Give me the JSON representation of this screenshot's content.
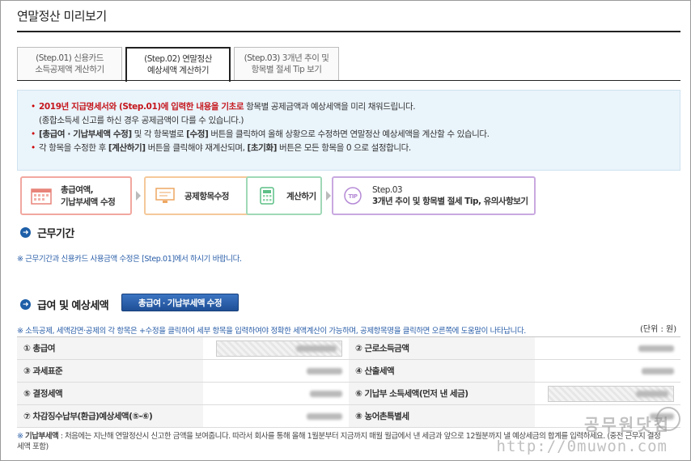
{
  "page": {
    "title": "연말정산 미리보기"
  },
  "tabs": [
    {
      "step": "(Step.01)",
      "line1": "신용카드",
      "line2": "소득공제액 계산하기",
      "active": false
    },
    {
      "step": "(Step.02)",
      "line1": "연말정산",
      "line2": "예상세액 계산하기",
      "active": true
    },
    {
      "step": "(Step.03)",
      "line1": "3개년 추이 및",
      "line2": "항목별 절세 Tip 보기",
      "active": false
    }
  ],
  "info": {
    "line1_red": "2019년 지급명세서와 (Step.01)에 입력한 내용을 기초로",
    "line1_rest": " 항목별 공제금액과 예상세액을 미리 채워드립니다.",
    "line1_sub": "(종합소득세 신고를 하신 경우 공제금액이 다를 수 있습니다.)",
    "line2_b1": "[총급여 · 기납부세액 수정]",
    "line2_mid": " 및 각 항목별로 ",
    "line2_b2": "[수정]",
    "line2_rest": " 버튼을 클릭하여 올해 상황으로 수정하면 연말정산 예상세액을 계산할 수 있습니다.",
    "line3_a": "각 항목을 수정한 후 ",
    "line3_b1": "[계산하기]",
    "line3_mid": " 버튼을 클릭해야 재계산되며, ",
    "line3_b2": "[초기화]",
    "line3_rest": " 버튼은 모든 항목을 0 으로 설정합니다."
  },
  "steps": [
    {
      "line1": "총급여액,",
      "line2": "기납부세액 수정",
      "color": "#f2a7a0",
      "icon": "calendar-icon"
    },
    {
      "line1": "공제항목수정",
      "line2": "",
      "color": "#f5c89a",
      "icon": "monitor-icon"
    },
    {
      "line1": "계산하기",
      "line2": "",
      "color": "#9fd9b6",
      "icon": "calculator-icon"
    },
    {
      "line1": "Step.03",
      "line2": "3개년 추이 및 항목별 절세 Tip, 유의사항보기",
      "color": "#c9a9e0",
      "icon": "tip-icon",
      "tip_label": "TIP"
    }
  ],
  "section_work": {
    "title": "근무기간",
    "note": "※ 근무기간과 신용카드 사용금액 수정은 [Step.01]에서 하시기 바랍니다."
  },
  "section_salary": {
    "title": "급여 및 예상세액",
    "edit_button": "총급여 · 기납부세액 수정",
    "note": "※ 소득공제, 세액감면·공제의 각 항목은 +수정을 클릭하여 세부 항목을 입력하여야 정확한 세액계산이 가능하며, 공제항목명을 클릭하면 오른쪽에 도움말이 나타납니다.",
    "unit": "(단위 : 원)",
    "rows": [
      {
        "l_label": "① 총급여",
        "l_boxed": true,
        "r_label": "② 근로소득금액",
        "r_boxed": false
      },
      {
        "l_label": "③ 과세표준",
        "l_boxed": false,
        "r_label": "④ 산출세액",
        "r_boxed": false
      },
      {
        "l_label": "⑤ 결정세액",
        "l_boxed": false,
        "r_label": "⑥ 기납부 소득세액(먼저 낸 세금)",
        "r_boxed": true
      },
      {
        "l_label": "⑦ 차감징수납부(환급)예상세액(⑤-⑥)",
        "l_boxed": false,
        "r_label": "⑧ 농어촌특별세",
        "r_boxed": false
      }
    ]
  },
  "footnote": {
    "mark": "※",
    "label": "기납부세액",
    "text": " : 처음에는 지난해 연말정산시 신고한 금액을 보여줍니다. 따라서 회사를 통해 올해 1월분부터 지금까지 매월 월급에서 낸 세금과 앞으로 12월분까지 낼 예상세금의 합계를 입력하세요. (중전 근무지 결정세액 포함)"
  },
  "watermark": {
    "text": "공무원닷컴",
    "url": "http://0muwon.com"
  }
}
